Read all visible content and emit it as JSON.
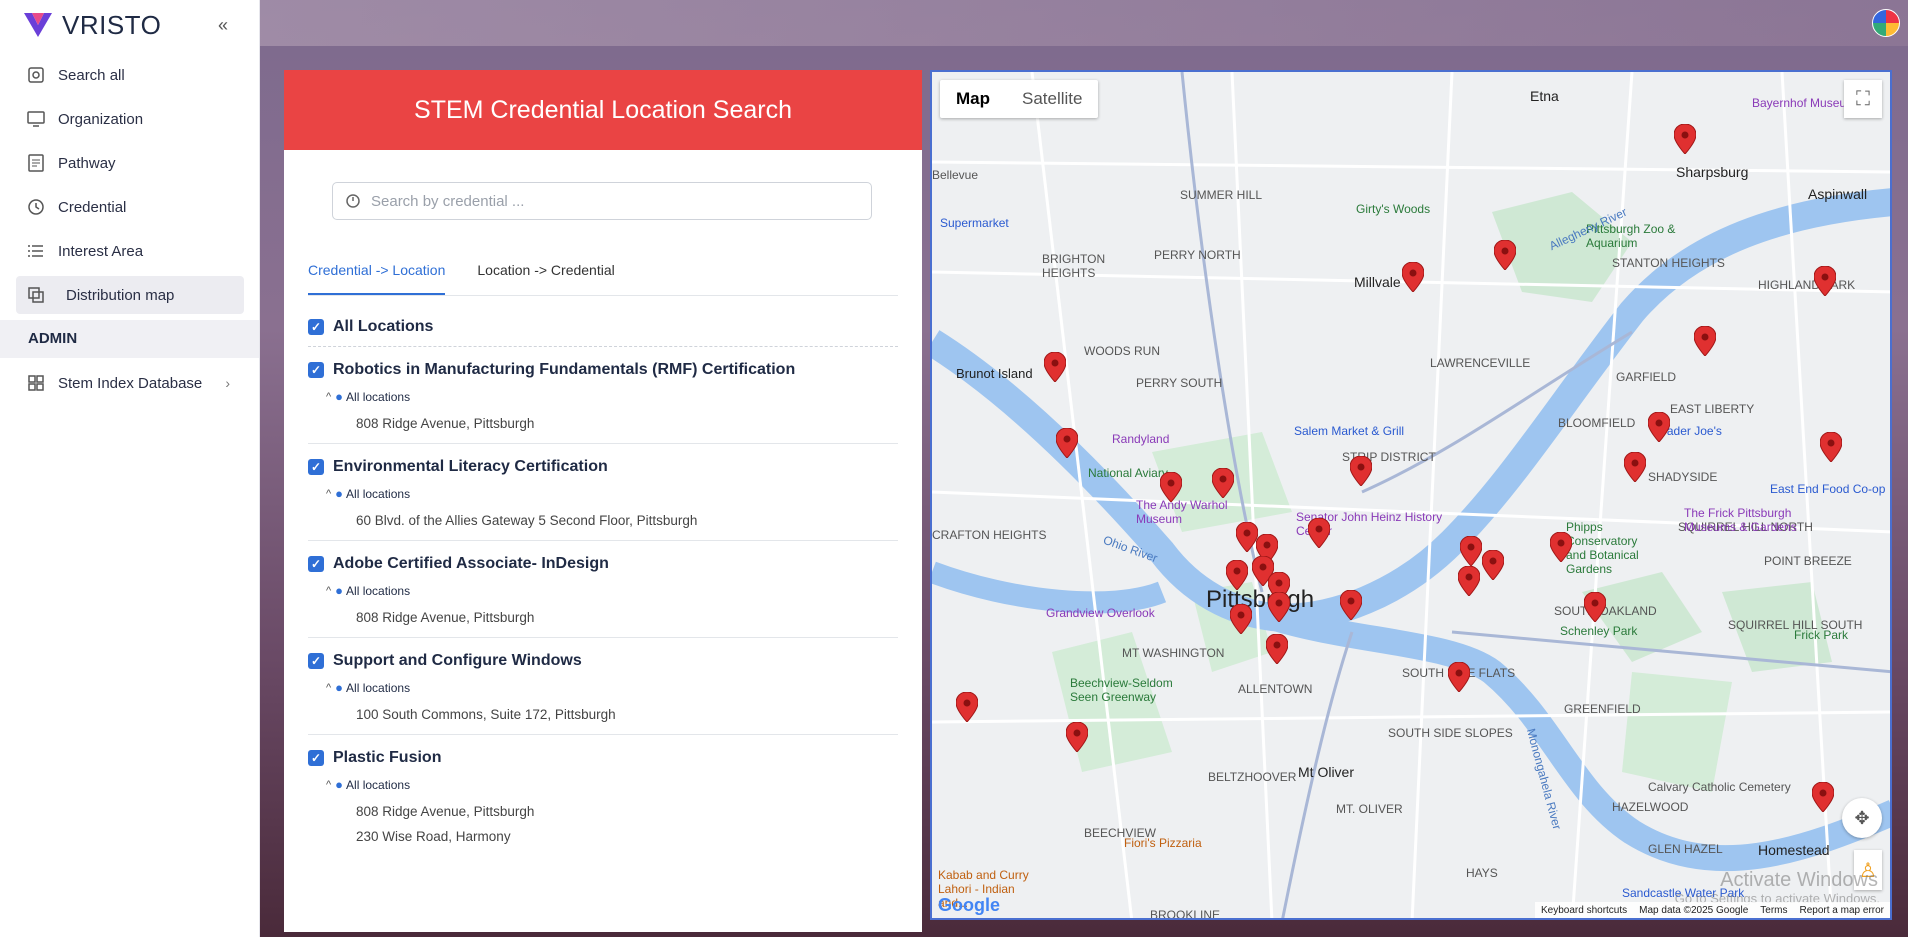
{
  "app": {
    "logo": "VRISTO"
  },
  "sidebar": {
    "items": [
      {
        "label": "Search all",
        "icon": "search-icon"
      },
      {
        "label": "Organization",
        "icon": "monitor-icon"
      },
      {
        "label": "Pathway",
        "icon": "document-icon"
      },
      {
        "label": "Credential",
        "icon": "clock-icon"
      },
      {
        "label": "Interest Area",
        "icon": "list-icon"
      },
      {
        "label": "Distribution map",
        "icon": "map-icon",
        "active": true
      }
    ],
    "section": "ADMIN",
    "admin_items": [
      {
        "label": "Stem Index Database",
        "icon": "grid-icon"
      }
    ]
  },
  "panel": {
    "title": "STEM Credential Location Search",
    "search_placeholder": "Search by credential ...",
    "tabs": [
      "Credential -> Location",
      "Location -> Credential"
    ],
    "all_label": "All Locations",
    "credentials": [
      {
        "name": "Robotics in Manufacturing Fundamentals (RMF) Certification",
        "loc_label": "All locations",
        "addresses": [
          "808 Ridge Avenue, Pittsburgh"
        ]
      },
      {
        "name": "Environmental Literacy Certification",
        "loc_label": "All locations",
        "addresses": [
          "60 Blvd. of the Allies Gateway 5 Second Floor, Pittsburgh"
        ]
      },
      {
        "name": "Adobe Certified Associate- InDesign",
        "loc_label": "All locations",
        "addresses": [
          "808 Ridge Avenue, Pittsburgh"
        ]
      },
      {
        "name": "Support and Configure Windows",
        "loc_label": "All locations",
        "addresses": [
          "100 South Commons, Suite 172, Pittsburgh"
        ]
      },
      {
        "name": "Plastic Fusion",
        "loc_label": "All locations",
        "addresses": [
          "808 Ridge Avenue, Pittsburgh",
          "230 Wise Road, Harmony"
        ]
      }
    ]
  },
  "map": {
    "type_buttons": [
      "Map",
      "Satellite"
    ],
    "labels": [
      "Etna",
      "Sharpsburg",
      "Aspinwall",
      "Millvale",
      "SUMMER HILL",
      "PERRY NORTH",
      "BRIGHTON HEIGHTS",
      "WOODS RUN",
      "PERRY SOUTH",
      "Brunot Island",
      "LAWRENCEVILLE",
      "STANTON HEIGHTS",
      "HIGHLAND PARK",
      "GARFIELD",
      "BLOOMFIELD",
      "EAST LIBERTY",
      "STRIP DISTRICT",
      "Pittsburgh",
      "SHADYSIDE",
      "SQUIRREL HILL NORTH",
      "POINT BREEZE",
      "SOUTH OAKLAND",
      "SQUIRREL HILL SOUTH",
      "Frick Park",
      "Schenley Park",
      "CRAFTON HEIGHTS",
      "MT WASHINGTON",
      "ALLENTOWN",
      "SOUTH SIDE FLATS",
      "SOUTH SIDE SLOPES",
      "GREENFIELD",
      "Calvary Catholic Cemetery",
      "Mt Oliver",
      "MT. OLIVER",
      "BELTZHOOVER",
      "BEECHVIEW",
      "HAZELWOOD",
      "GLEN HAZEL",
      "Homestead",
      "HAYS",
      "BROOKLINE",
      "Bayernhof Museum",
      "Pittsburgh Zoo & Aquarium",
      "Randyland",
      "National Aviary",
      "The Andy Warhol Museum",
      "Senator John Heinz History Center",
      "Salem Market & Grill",
      "Trader Joe's",
      "East End Food Co-op",
      "The Frick Pittsburgh Museums & Gardens",
      "Phipps Conservatory and Botanical Gardens",
      "Grandview Overlook",
      "Beechview-Seldom Seen Greenway",
      "Fiori's Pizzaria",
      "Kabab and Curry Lahori - Indian and...",
      "Sandcastle Water Park",
      "Girty's Woods",
      "Bellevue",
      "Supermarket",
      "Allegheny River",
      "Ohio River",
      "Monongahela River"
    ],
    "footer": [
      "Keyboard shortcuts",
      "Map data ©2025 Google",
      "Terms",
      "Report a map error"
    ],
    "brand": "Google",
    "watermark": "Activate Windows",
    "watermark_sub": "Go to Settings to activate Windows."
  }
}
